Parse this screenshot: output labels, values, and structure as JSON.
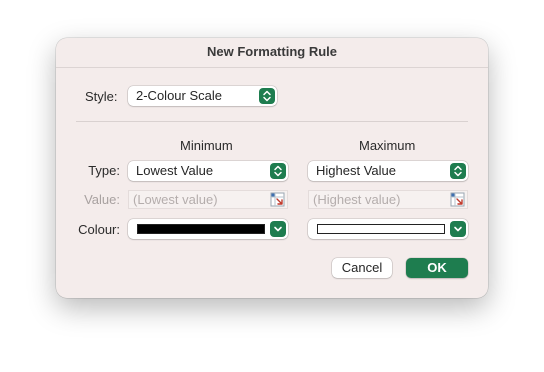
{
  "dialog": {
    "title": "New Formatting Rule"
  },
  "style": {
    "label": "Style:",
    "value": "2-Colour Scale",
    "icon": "up-down-chevron-icon"
  },
  "columns": {
    "minimum_header": "Minimum",
    "maximum_header": "Maximum"
  },
  "type_row": {
    "label": "Type:",
    "minimum_value": "Lowest Value",
    "maximum_value": "Highest Value"
  },
  "value_row": {
    "label": "Value:",
    "minimum_placeholder": "(Lowest value)",
    "maximum_placeholder": "(Highest value)",
    "icon": "range-select-icon"
  },
  "colour_row": {
    "label": "Colour:",
    "minimum_colour": "#000000",
    "maximum_colour": "#ffffff",
    "icon": "chevron-down-icon"
  },
  "buttons": {
    "cancel": "Cancel",
    "ok": "OK"
  },
  "colors": {
    "accent": "#1e7d4f",
    "dialog_background": "#f4eceb"
  }
}
